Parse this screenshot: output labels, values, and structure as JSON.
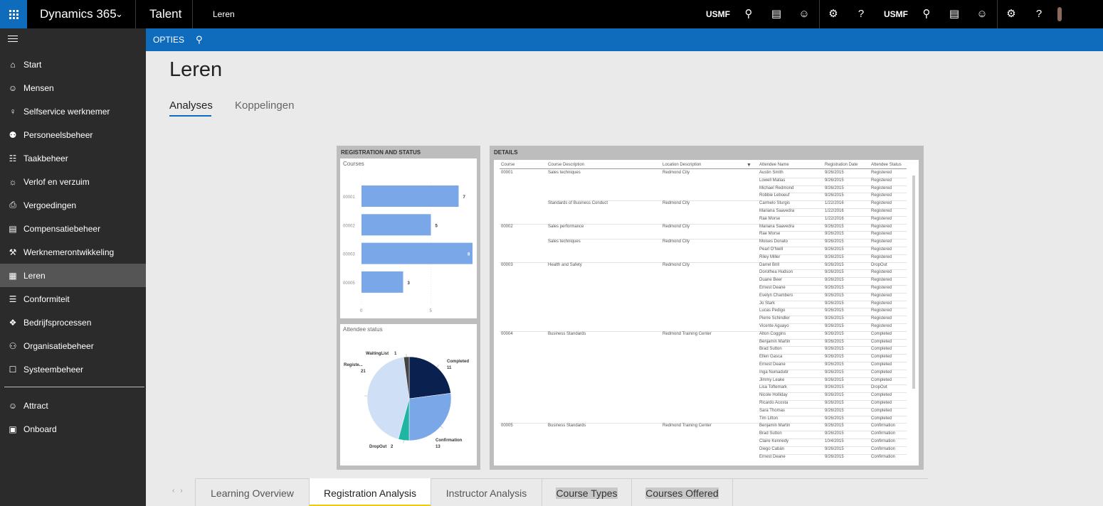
{
  "topbar": {
    "app_name": "Dynamics 365",
    "product_name": "Talent",
    "page_crumb": "Leren",
    "company_1": "USMF",
    "company_2": "USMF"
  },
  "actionbar": {
    "options_label": "OPTIES"
  },
  "sidebar": {
    "items": [
      {
        "label": "Start",
        "icon": "home-icon"
      },
      {
        "label": "Mensen",
        "icon": "people-icon"
      },
      {
        "label": "Selfservice werknemer",
        "icon": "person-icon"
      },
      {
        "label": "Personeelsbeheer",
        "icon": "group-icon"
      },
      {
        "label": "Taakbeheer",
        "icon": "clipboard-icon"
      },
      {
        "label": "Verlof en verzuim",
        "icon": "person-clock-icon"
      },
      {
        "label": "Vergoedingen",
        "icon": "document-icon"
      },
      {
        "label": "Compensatiebeheer",
        "icon": "money-icon"
      },
      {
        "label": "Werknemerontwikkeling",
        "icon": "development-icon"
      },
      {
        "label": "Leren",
        "icon": "learning-icon"
      },
      {
        "label": "Conformiteit",
        "icon": "list-icon"
      },
      {
        "label": "Bedrijfsprocessen",
        "icon": "process-icon"
      },
      {
        "label": "Organisatiebeheer",
        "icon": "org-icon"
      },
      {
        "label": "Systeembeheer",
        "icon": "system-icon"
      },
      {
        "label": "Attract",
        "icon": "attract-icon"
      },
      {
        "label": "Onboard",
        "icon": "onboard-icon"
      }
    ],
    "active_label": "Leren"
  },
  "main": {
    "title": "Leren",
    "tabs": [
      {
        "label": "Analyses"
      },
      {
        "label": "Koppelingen"
      }
    ]
  },
  "report": {
    "registration_panel_title": "REGISTRATION AND STATUS",
    "details_panel_title": "DETAILS",
    "courses_card_title": "Courses",
    "status_card_title": "Attendee status",
    "table": {
      "headers": [
        "Course",
        "Course Description",
        "Location Description",
        "Attendee Name",
        "Registration Date",
        "Attendee Status"
      ],
      "groups": [
        {
          "course": "00001",
          "description": "Sales techniques",
          "location": "Redmond City",
          "rows": [
            [
              "Austin Smith",
              "9/26/2015",
              "Registered"
            ],
            [
              "Lowell Matias",
              "9/26/2015",
              "Registered"
            ],
            [
              "Michael Redmond",
              "9/26/2015",
              "Registered"
            ],
            [
              "Robbie Leboeuf",
              "9/26/2015",
              "Registered"
            ]
          ]
        },
        {
          "course": "",
          "description": "Standards of Business Conduct",
          "location": "Redmond City",
          "rows": [
            [
              "Carmelo Sturgis",
              "1/22/2016",
              "Registered"
            ],
            [
              "Mariana Saavedra",
              "1/22/2016",
              "Registered"
            ],
            [
              "Rae Morse",
              "1/22/2016",
              "Registered"
            ]
          ]
        },
        {
          "course": "00002",
          "description": "Sales performance",
          "location": "Redmond City",
          "rows": [
            [
              "Mariana Saavedra",
              "9/26/2015",
              "Registered"
            ],
            [
              "Rae Morse",
              "9/26/2015",
              "Registered"
            ]
          ]
        },
        {
          "course": "",
          "description": "Sales techniques",
          "location": "Redmond City",
          "rows": [
            [
              "Moises Donato",
              "9/26/2015",
              "Registered"
            ],
            [
              "Pearl O'Neill",
              "9/26/2015",
              "Registered"
            ],
            [
              "Riley Miller",
              "9/26/2015",
              "Registered"
            ]
          ]
        },
        {
          "course": "00003",
          "description": "Health and Safety",
          "location": "Redmond City",
          "rows": [
            [
              "Darrel Brill",
              "9/26/2015",
              "DropOut"
            ],
            [
              "Dorothea Hudson",
              "9/26/2015",
              "Registered"
            ],
            [
              "Duane Beer",
              "9/26/2015",
              "Registered"
            ],
            [
              "Ernest Deane",
              "9/26/2015",
              "Registered"
            ],
            [
              "Evelyn Chambers",
              "9/26/2015",
              "Registered"
            ],
            [
              "Jo Stark",
              "9/26/2015",
              "Registered"
            ],
            [
              "Lucas Pedigo",
              "9/26/2015",
              "Registered"
            ],
            [
              "Pierre Schindler",
              "9/26/2015",
              "Registered"
            ],
            [
              "Vicente Aguayo",
              "9/26/2015",
              "Registered"
            ]
          ]
        },
        {
          "course": "00004",
          "description": "Business Standards",
          "location": "Redmond Training Center",
          "rows": [
            [
              "Alton Coggins",
              "9/26/2015",
              "Completed"
            ],
            [
              "Benjamin Martin",
              "9/26/2015",
              "Completed"
            ],
            [
              "Brad Sutton",
              "9/26/2015",
              "Completed"
            ],
            [
              "Ellen Gasca",
              "9/26/2015",
              "Completed"
            ],
            [
              "Ernest Deane",
              "9/26/2015",
              "Completed"
            ],
            [
              "Inga Numadutir",
              "9/26/2015",
              "Completed"
            ],
            [
              "Jimmy Leake",
              "9/26/2015",
              "Completed"
            ],
            [
              "Lisa Toftemark",
              "9/26/2015",
              "DropOut"
            ],
            [
              "Nicole Holliday",
              "9/26/2015",
              "Completed"
            ],
            [
              "Ricardo Acosta",
              "9/26/2015",
              "Completed"
            ],
            [
              "Sara Thomas",
              "9/26/2015",
              "Completed"
            ],
            [
              "Tim Litton",
              "9/26/2015",
              "Completed"
            ]
          ]
        },
        {
          "course": "00005",
          "description": "Business Standards",
          "location": "Redmond Training Center",
          "rows": [
            [
              "Benjamin Martin",
              "9/26/2015",
              "Confirmation"
            ],
            [
              "Brad Sutton",
              "9/26/2015",
              "Confirmation"
            ],
            [
              "Claire Kennedy",
              "10/4/2015",
              "Confirmation"
            ],
            [
              "Diego Cabán",
              "9/26/2015",
              "Confirmation"
            ],
            [
              "Ernest Deane",
              "9/26/2015",
              "Confirmation"
            ]
          ]
        }
      ]
    },
    "report_tabs": [
      {
        "label": "Learning Overview"
      },
      {
        "label": "Registration Analysis"
      },
      {
        "label": "Instructor Analysis"
      },
      {
        "label": "Course Types"
      },
      {
        "label": "Courses Offered"
      }
    ],
    "active_report_tab": "Registration Analysis"
  },
  "chart_data": [
    {
      "type": "bar",
      "title": "Courses",
      "orientation": "horizontal",
      "categories": [
        "00001",
        "00002",
        "00003",
        "00005"
      ],
      "values": [
        7,
        5,
        8,
        3
      ],
      "xlim": [
        0,
        8
      ],
      "x_ticks": [
        0,
        5
      ],
      "bar_color": "#7aa7e8",
      "grid": false
    },
    {
      "type": "pie",
      "title": "Attendee status",
      "labels": [
        "Completed",
        "Confirmation",
        "DropOut",
        "Registe...",
        "WaitingList"
      ],
      "values": [
        11,
        13,
        2,
        21,
        1
      ],
      "colors": [
        "#0a2150",
        "#7aa7e8",
        "#1fb5a3",
        "#cfdff5",
        "#444444"
      ]
    }
  ]
}
